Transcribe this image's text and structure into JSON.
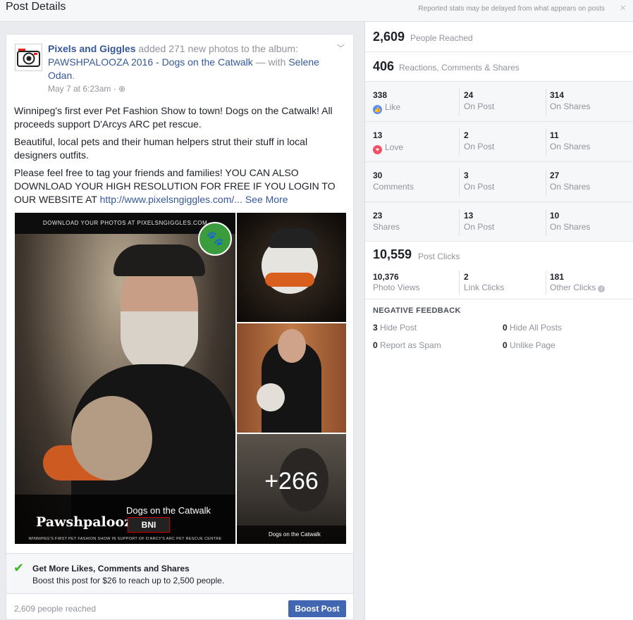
{
  "header": {
    "title": "Post Details",
    "notice": "Reported stats may be delayed from what appears on posts",
    "close": "×"
  },
  "post": {
    "page_name": "Pixels and Giggles",
    "action": " added 271 new photos to the album: ",
    "album": "PAWSHPALOOZA 2016 - Dogs on the Catwalk",
    "with_sep": " — with ",
    "tagged": "Selene Odan",
    "period": ".",
    "timestamp": "May 7 at 6:23am · ",
    "globe": "⊕",
    "menu": "﹀",
    "para1": "Winnipeg's first ever Pet Fashion Show to town! Dogs on the Catwalk! All proceeds support D'Arcys ARC pet rescue.",
    "para2": "Beautiful, local pets and their human helpers strut their stuff in local designers outfits.",
    "para3": "Please feel free to tag your friends and families! YOU CAN ALSO DOWNLOAD YOUR HIGH RESOLUTION FOR FREE IF YOU LOGIN TO OUR WEBSITE AT ",
    "url": "http://www.pixelsngiggles.com/...",
    "see_more": " See More",
    "photo_banner": "DOWNLOAD YOUR PHOTOS AT PIXELSNGIGGLES.COM",
    "photo_brand": "Pawshpalooza",
    "photo_caption": "Dogs on the Catwalk",
    "photo_bni": "BNI",
    "photo_fine": "WINNIPEG'S FIRST PET FASHION SHOW IN SUPPORT OF D'ARCY'S ARC PET RESCUE CENTRE",
    "photo_small_caption": "Dogs on the Catwalk",
    "more_photos": "+266",
    "boost_title": "Get More Likes, Comments and Shares",
    "boost_desc": "Boost this post for $26 to reach up to 2,500 people.",
    "people_reached": "2,609 people reached",
    "boost_button": "Boost Post"
  },
  "stats": {
    "reached_num": "2,609",
    "reached_label": "People Reached",
    "reactions_num": "406",
    "reactions_label": "Reactions, Comments & Shares",
    "rows": [
      {
        "total": "338",
        "label": "Like",
        "icon": "like-icon",
        "on_post": "24",
        "on_post_label": "On Post",
        "on_shares": "314",
        "on_shares_label": "On Shares"
      },
      {
        "total": "13",
        "label": "Love",
        "icon": "love-icon",
        "on_post": "2",
        "on_post_label": "On Post",
        "on_shares": "11",
        "on_shares_label": "On Shares"
      },
      {
        "total": "30",
        "label": "Comments",
        "on_post": "3",
        "on_post_label": "On Post",
        "on_shares": "27",
        "on_shares_label": "On Shares"
      },
      {
        "total": "23",
        "label": "Shares",
        "on_post": "13",
        "on_post_label": "On Post",
        "on_shares": "10",
        "on_shares_label": "On Shares"
      }
    ],
    "clicks_num": "10,559",
    "clicks_label": "Post Clicks",
    "photo_views": "10,376",
    "photo_views_label": "Photo Views",
    "link_clicks": "2",
    "link_clicks_label": "Link Clicks",
    "other_clicks": "181",
    "other_clicks_label": "Other Clicks",
    "negative_title": "NEGATIVE FEEDBACK",
    "hide_post_num": "3",
    "hide_post_label": " Hide Post",
    "hide_all_num": "0",
    "hide_all_label": " Hide All Posts",
    "spam_num": "0",
    "spam_label": " Report as Spam",
    "unlike_num": "0",
    "unlike_label": " Unlike Page"
  },
  "colors": {
    "link": "#365899",
    "boost_button": "#4267b2",
    "like_icon": "#5890ff",
    "love_icon": "#f25268",
    "check": "#42b72a"
  }
}
